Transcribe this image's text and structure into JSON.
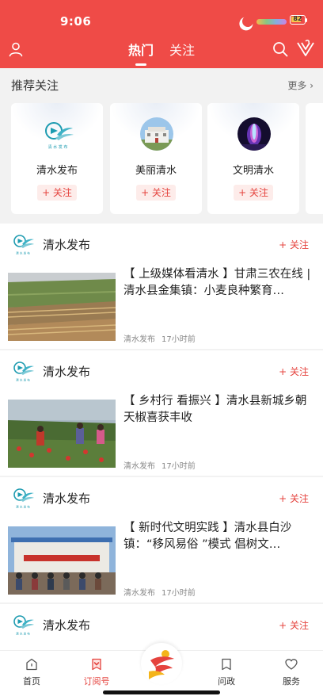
{
  "status_bar": {
    "time": "9:06",
    "battery": "82",
    "battery_level": 0.82
  },
  "header": {
    "tabs": [
      {
        "label": "热门",
        "active": true
      },
      {
        "label": "关注",
        "active": false
      }
    ],
    "icons": {
      "left": "user-icon",
      "right": [
        "search-icon",
        "app-logo-icon"
      ]
    }
  },
  "recommended": {
    "title": "推荐关注",
    "more_label": "更多",
    "cards": [
      {
        "name": "清水发布",
        "follow_label": "+ 关注",
        "avatar": "qingshui-release-logo"
      },
      {
        "name": "美丽清水",
        "follow_label": "+ 关注",
        "avatar": "building-photo-avatar"
      },
      {
        "name": "文明清水",
        "follow_label": "+ 关注",
        "avatar": "fountain-photo-avatar"
      }
    ]
  },
  "feed": [
    {
      "source": "清水发布",
      "follow_label": "+ 关注",
      "headline": "【 上级媒体看清水 】甘肃三农在线 | 清水县金集镇：小麦良种繁育…",
      "meta_source": "清水发布",
      "time": "17小时前",
      "thumbnail": "terraced-fields-photo"
    },
    {
      "source": "清水发布",
      "follow_label": "+ 关注",
      "headline": "【 乡村行 看振兴 】清水县新城乡朝天椒喜获丰收",
      "meta_source": "清水发布",
      "time": "17小时前",
      "thumbnail": "pepper-harvest-photo"
    },
    {
      "source": "清水发布",
      "follow_label": "+ 关注",
      "headline": "【 新时代文明实践 】清水县白沙镇：“移风易俗 ”模式 倡树文…",
      "meta_source": "清水发布",
      "time": "17小时前",
      "thumbnail": "village-gathering-photo"
    },
    {
      "source": "清水发布",
      "follow_label": "+ 关注"
    }
  ],
  "bottom_nav": [
    {
      "label": "首页",
      "icon": "home-icon",
      "active": false
    },
    {
      "label": "订阅号",
      "icon": "subscription-icon",
      "active": true
    },
    {
      "label": "",
      "icon": "center-logo-icon",
      "active": false
    },
    {
      "label": "问政",
      "icon": "inquiry-icon",
      "active": false
    },
    {
      "label": "服务",
      "icon": "service-heart-icon",
      "active": false
    }
  ],
  "colors": {
    "brand": "#ef4b47",
    "accent_text": "#e5433e",
    "follow_bg": "#fdecea"
  }
}
